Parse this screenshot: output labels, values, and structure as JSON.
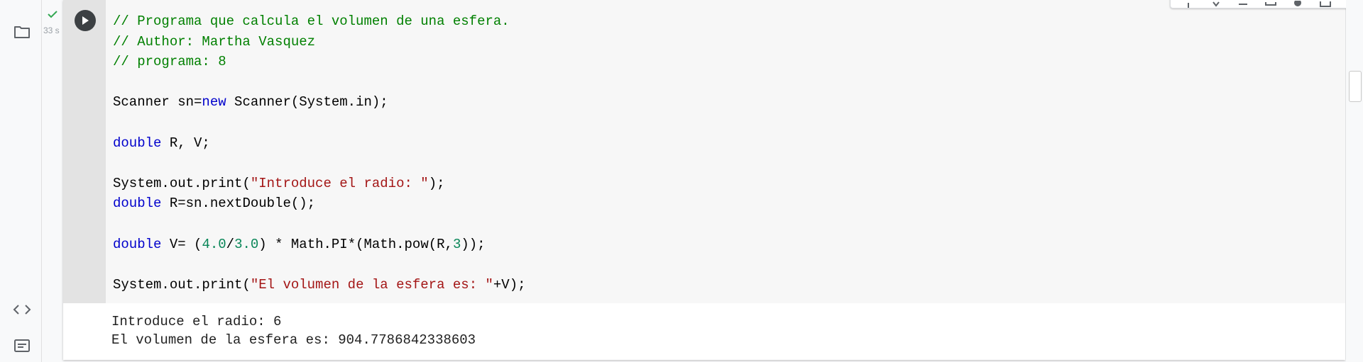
{
  "cell_status": {
    "elapsed": "33 s"
  },
  "code_lines": [
    [
      {
        "t": "// Programa que calcula el volumen de una esfera.",
        "c": "comment"
      }
    ],
    [
      {
        "t": "// Author: Martha Vasquez",
        "c": "comment"
      }
    ],
    [
      {
        "t": "// programa: 8",
        "c": "comment"
      }
    ],
    [],
    [
      {
        "t": "Scanner sn=",
        "c": "plain"
      },
      {
        "t": "new",
        "c": "keyword"
      },
      {
        "t": " Scanner(System.in);",
        "c": "plain"
      }
    ],
    [],
    [
      {
        "t": "double",
        "c": "keyword"
      },
      {
        "t": " R, V;",
        "c": "plain"
      }
    ],
    [],
    [
      {
        "t": "System.out.print(",
        "c": "plain"
      },
      {
        "t": "\"Introduce el radio: \"",
        "c": "string"
      },
      {
        "t": ");",
        "c": "plain"
      }
    ],
    [
      {
        "t": "double",
        "c": "keyword"
      },
      {
        "t": " R=sn.nextDouble();",
        "c": "plain"
      }
    ],
    [],
    [
      {
        "t": "double",
        "c": "keyword"
      },
      {
        "t": " V= (",
        "c": "plain"
      },
      {
        "t": "4.0",
        "c": "number"
      },
      {
        "t": "/",
        "c": "plain"
      },
      {
        "t": "3.0",
        "c": "number"
      },
      {
        "t": ") * Math.PI*(Math.pow(R,",
        "c": "plain"
      },
      {
        "t": "3",
        "c": "number"
      },
      {
        "t": "));",
        "c": "plain"
      }
    ],
    [],
    [
      {
        "t": "System.out.print(",
        "c": "plain"
      },
      {
        "t": "\"El volumen de la esfera es: \"",
        "c": "string"
      },
      {
        "t": "+V);",
        "c": "plain"
      }
    ]
  ],
  "output": {
    "line1": "Introduce el radio: 6",
    "line2": "El volumen de la esfera es: 904.7786842338603"
  },
  "icons": {
    "sidebar": [
      "folder-icon",
      "code-snippets-icon",
      "terminal-icon"
    ],
    "toolbar": [
      "move-up-icon",
      "move-down-icon",
      "link-icon",
      "comment-icon",
      "settings-icon",
      "mirror-cell-icon",
      "delete-icon",
      "more-options-icon"
    ]
  },
  "colors": {
    "comment": "#008000",
    "keyword": "#0000cc",
    "string": "#a31515",
    "number": "#098658",
    "check": "#34a853",
    "run_button": "#3c4043"
  }
}
